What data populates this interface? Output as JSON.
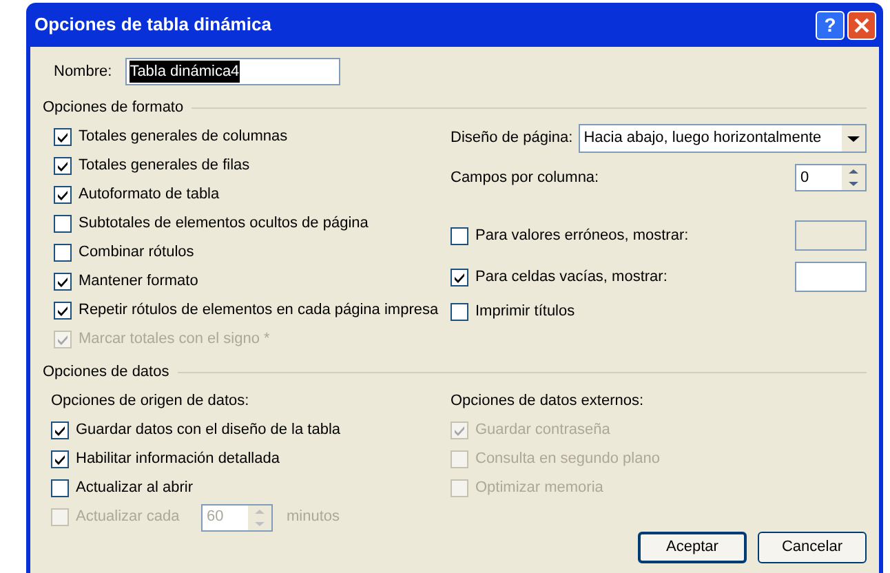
{
  "window": {
    "title": "Opciones de tabla dinámica",
    "help": "?"
  },
  "name": {
    "label": "Nombre:",
    "value": "Tabla dinámica4",
    "selected": true
  },
  "format_options": {
    "title": "Opciones de formato",
    "checkboxes": [
      {
        "label": "Totales generales de columnas",
        "checked": true,
        "disabled": false
      },
      {
        "label": "Totales generales de filas",
        "checked": true,
        "disabled": false
      },
      {
        "label": "Autoformato de tabla",
        "checked": true,
        "disabled": false
      },
      {
        "label": "Subtotales de elementos ocultos de página",
        "checked": false,
        "disabled": false
      },
      {
        "label": "Combinar rótulos",
        "checked": false,
        "disabled": false
      },
      {
        "label": "Mantener formato",
        "checked": true,
        "disabled": false
      },
      {
        "label": "Repetir rótulos de elementos en cada página impresa",
        "checked": true,
        "disabled": false
      },
      {
        "label": "Marcar totales con el signo *",
        "checked": true,
        "disabled": true
      }
    ],
    "page_layout": {
      "label": "Diseño de página:",
      "value": "Hacia abajo, luego horizontalmente"
    },
    "fields_per_column": {
      "label": "Campos por columna:",
      "value": "0"
    },
    "right_checkboxes": [
      {
        "kind": "field",
        "label": "Para valores erróneos, mostrar:",
        "checked": false,
        "field_disabled": true
      },
      {
        "kind": "field",
        "label": "Para celdas vacías, mostrar:",
        "checked": true,
        "field_disabled": false
      },
      {
        "kind": "plain",
        "label": "Imprimir títulos",
        "checked": false
      }
    ]
  },
  "data_options": {
    "title": "Opciones de datos",
    "source": {
      "heading": "Opciones de origen de datos:",
      "checkboxes": [
        {
          "kind": "plain",
          "label": "Guardar datos con el diseño de la tabla",
          "checked": true,
          "disabled": false
        },
        {
          "kind": "plain",
          "label": "Habilitar información detallada",
          "checked": true,
          "disabled": false
        },
        {
          "kind": "plain",
          "label": "Actualizar al abrir",
          "checked": false,
          "disabled": false
        },
        {
          "kind": "interval",
          "label": "Actualizar cada",
          "checked": false,
          "disabled": true,
          "value": "60",
          "unit": "minutos"
        }
      ]
    },
    "external": {
      "heading": "Opciones de datos externos:",
      "checkboxes": [
        {
          "label": "Guardar contraseña",
          "checked": true,
          "disabled": true
        },
        {
          "label": "Consulta en segundo plano",
          "checked": false,
          "disabled": true
        },
        {
          "label": "Optimizar memoria",
          "checked": false,
          "disabled": true
        }
      ]
    }
  },
  "buttons": [
    {
      "label": "Aceptar",
      "default": true
    },
    {
      "label": "Cancelar",
      "default": false
    }
  ]
}
